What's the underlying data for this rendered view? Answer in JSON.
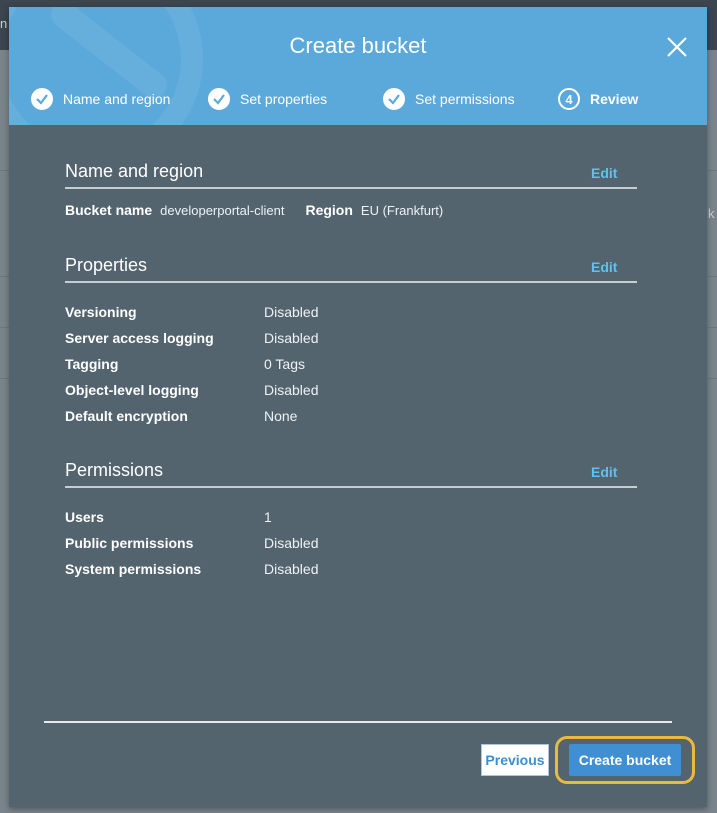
{
  "backdrop": {
    "fragment_left": "n",
    "fragment_right": "k"
  },
  "modal": {
    "title": "Create bucket",
    "close_icon": "close-icon"
  },
  "steps": [
    {
      "number": "1",
      "label": "Name and region",
      "status": "complete"
    },
    {
      "number": "2",
      "label": "Set properties",
      "status": "complete"
    },
    {
      "number": "3",
      "label": "Set permissions",
      "status": "complete"
    },
    {
      "number": "4",
      "label": "Review",
      "status": "current"
    }
  ],
  "sections": {
    "name_region": {
      "title": "Name and region",
      "edit_label": "Edit",
      "bucket_name_label": "Bucket name",
      "bucket_name_value": "developerportal-client",
      "region_label": "Region",
      "region_value": "EU (Frankfurt)"
    },
    "properties": {
      "title": "Properties",
      "edit_label": "Edit",
      "rows": [
        {
          "label": "Versioning",
          "value": "Disabled"
        },
        {
          "label": "Server access logging",
          "value": "Disabled"
        },
        {
          "label": "Tagging",
          "value": "0 Tags"
        },
        {
          "label": "Object-level logging",
          "value": "Disabled"
        },
        {
          "label": "Default encryption",
          "value": "None"
        }
      ]
    },
    "permissions": {
      "title": "Permissions",
      "edit_label": "Edit",
      "rows": [
        {
          "label": "Users",
          "value": "1"
        },
        {
          "label": "Public permissions",
          "value": "Disabled"
        },
        {
          "label": "System permissions",
          "value": "Disabled"
        }
      ]
    }
  },
  "footer": {
    "previous_label": "Previous",
    "create_label": "Create bucket",
    "highlight_color": "#e8bb3c"
  },
  "colors": {
    "header_bg": "#5ba9da",
    "body_bg": "#53646f",
    "edit_link": "#5fc0f2",
    "primary_button": "#3f8fd2"
  }
}
